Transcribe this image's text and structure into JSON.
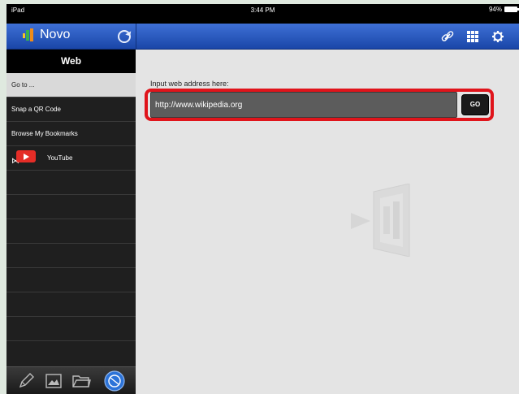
{
  "status_bar": {
    "device": "iPad",
    "time": "3:44 PM",
    "battery": "94%"
  },
  "nav": {
    "app_title": "Novo",
    "icons": [
      "app-logo-icon",
      "refresh-icon",
      "link-icon",
      "grid-icon",
      "settings-gear-icon"
    ]
  },
  "sidebar": {
    "header": "Web",
    "items": [
      {
        "label": "Go to ...",
        "selected": true
      },
      {
        "label": "Snap a QR Code"
      },
      {
        "label": "Browse My Bookmarks"
      },
      {
        "label": "YouTube",
        "icon": "youtube-icon"
      }
    ],
    "toolbar_icons": [
      "pen-icon",
      "image-icon",
      "folder-icon",
      "web-globe-icon"
    ]
  },
  "main": {
    "address_label": "Input web address here:",
    "address_value": "http://www.wikipedia.org",
    "go_label": "GO"
  },
  "colors": {
    "nav_blue": "#2a58c2",
    "highlight_red": "#e0141b",
    "sidebar_bg": "#1f1f1f",
    "main_bg": "#e4e4e4"
  }
}
